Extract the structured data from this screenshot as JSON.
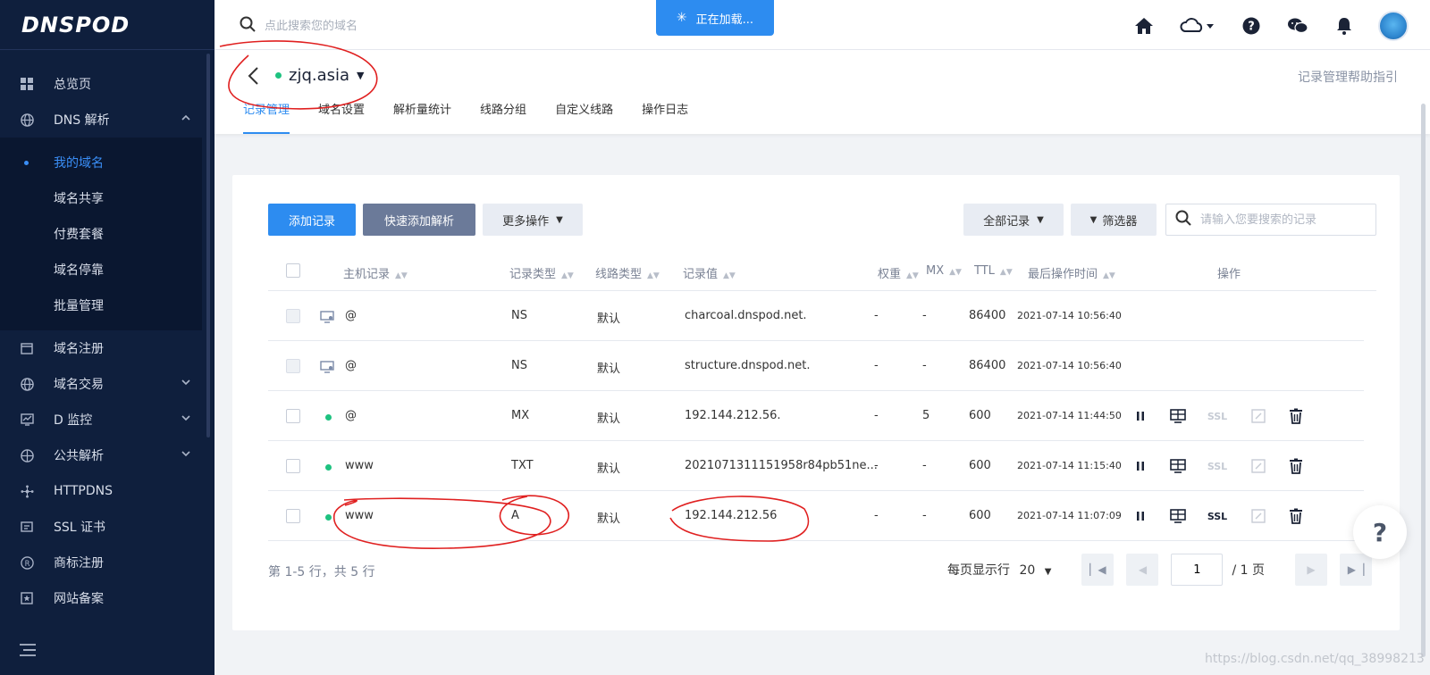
{
  "brand": {
    "logo_text": "DNSPOD"
  },
  "sidebar": {
    "items": [
      {
        "label": "总览页",
        "icon": "grid-icon"
      },
      {
        "label": "DNS 解析",
        "icon": "globe-icon",
        "expanded": true
      }
    ],
    "submenu": [
      {
        "label": "我的域名",
        "active": true
      },
      {
        "label": "域名共享"
      },
      {
        "label": "付费套餐"
      },
      {
        "label": "域名停靠"
      },
      {
        "label": "批量管理"
      }
    ],
    "items_after": [
      {
        "label": "域名注册",
        "icon": "calendar-icon"
      },
      {
        "label": "域名交易",
        "icon": "globe-icon",
        "has_chevron": true
      },
      {
        "label": "D 监控",
        "icon": "monitor-icon",
        "has_chevron": true
      },
      {
        "label": "公共解析",
        "icon": "network-globe-icon",
        "has_chevron": true
      },
      {
        "label": "HTTPDNS",
        "icon": "nodes-icon"
      },
      {
        "label": "SSL 证书",
        "icon": "certificate-icon"
      },
      {
        "label": "商标注册",
        "icon": "registered-icon"
      },
      {
        "label": "网站备案",
        "icon": "star-box-icon"
      }
    ]
  },
  "topbar": {
    "search_placeholder": "点此搜索您的域名",
    "loading_text": "正在加载..."
  },
  "domain": {
    "name": "zjq.asia",
    "status_color": "#1ec280",
    "help_link": "记录管理帮助指引",
    "tabs": [
      "记录管理",
      "域名设置",
      "解析量统计",
      "线路分组",
      "自定义线路",
      "操作日志"
    ],
    "active_tab": 0
  },
  "toolbar": {
    "add_record": "添加记录",
    "quick_add": "快速添加解析",
    "more_ops": "更多操作",
    "all_records": "全部记录",
    "filter": "筛选器",
    "search_placeholder": "请输入您要搜索的记录"
  },
  "table": {
    "headers": {
      "host": "主机记录",
      "type": "记录类型",
      "line": "线路类型",
      "value": "记录值",
      "weight": "权重",
      "mx": "MX",
      "ttl": "TTL",
      "time": "最后操作时间",
      "ops": "操作"
    },
    "rows": [
      {
        "host": "@",
        "type": "NS",
        "line": "默认",
        "value": "charcoal.dnspod.net.",
        "weight": "-",
        "mx": "-",
        "ttl": "86400",
        "time": "2021-07-14 10:56:40",
        "system": true
      },
      {
        "host": "@",
        "type": "NS",
        "line": "默认",
        "value": "structure.dnspod.net.",
        "weight": "-",
        "mx": "-",
        "ttl": "86400",
        "time": "2021-07-14 10:56:40",
        "system": true
      },
      {
        "host": "@",
        "type": "MX",
        "line": "默认",
        "value": "192.144.212.56.",
        "weight": "-",
        "mx": "5",
        "ttl": "600",
        "time": "2021-07-14 11:44:50",
        "ssl_label": "SSL"
      },
      {
        "host": "www",
        "type": "TXT",
        "line": "默认",
        "value": "2021071311151958r84pb51ne...",
        "weight": "-",
        "mx": "-",
        "ttl": "600",
        "time": "2021-07-14 11:15:40",
        "ssl_label": "SSL"
      },
      {
        "host": "www",
        "type": "A",
        "line": "默认",
        "value": "192.144.212.56",
        "weight": "-",
        "mx": "-",
        "ttl": "600",
        "time": "2021-07-14 11:07:09",
        "ssl_label": "SSL"
      }
    ]
  },
  "footer": {
    "count_text": "第 1-5 行，共 5 行",
    "per_page_label": "每页显示行",
    "per_page_value": "20",
    "page_value": "1",
    "total_pages": "/ 1 页"
  },
  "watermark": "https://blog.csdn.net/qq_38998213",
  "colors": {
    "accent": "#2d8cf0",
    "sidebar_bg": "#0f1f3d",
    "annotation_red": "#e02020"
  }
}
